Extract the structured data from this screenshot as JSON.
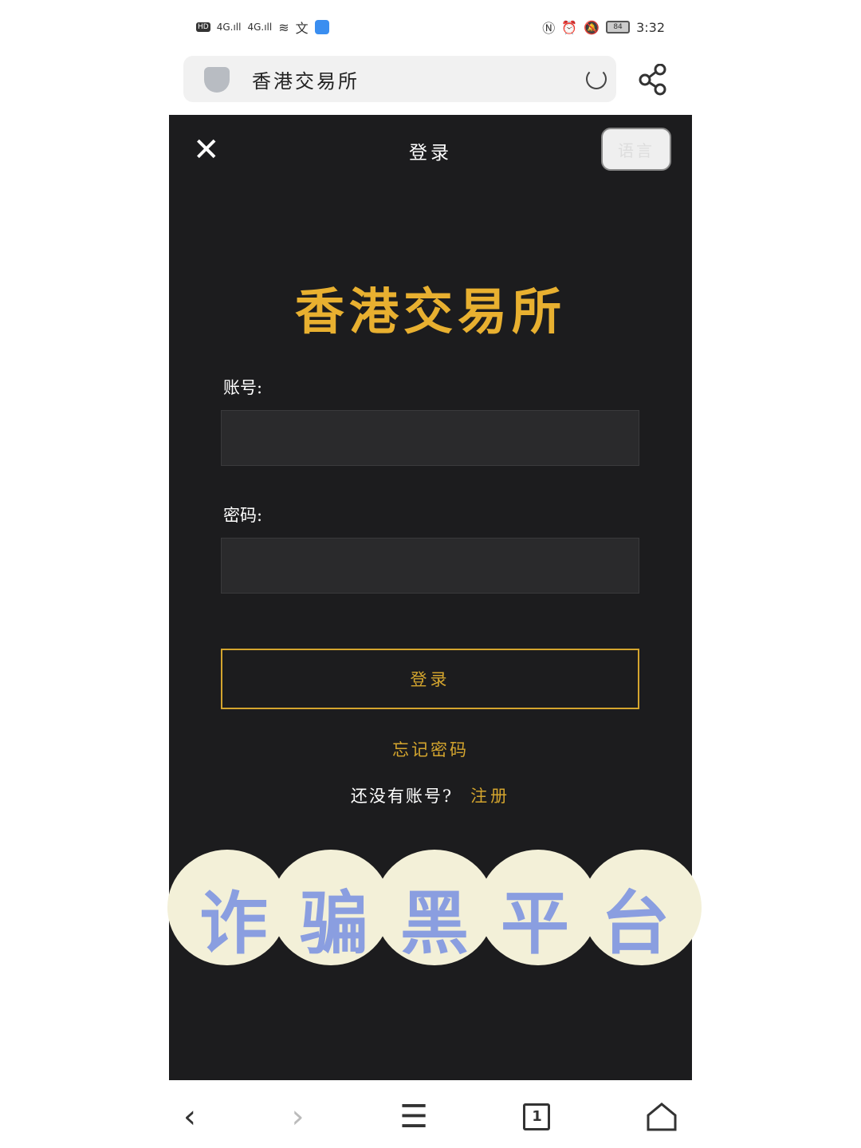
{
  "status": {
    "network": "4G",
    "battery": "84",
    "time": "3:32"
  },
  "browser": {
    "url_title": "香港交易所"
  },
  "header": {
    "title": "登录",
    "language_button": "语言"
  },
  "brand": "香港交易所",
  "form": {
    "account_label": "账号:",
    "account_value": "",
    "password_label": "密码:",
    "password_value": "",
    "login_button": "登录"
  },
  "forgot_password": "忘记密码",
  "register": {
    "prompt": "还没有账号?",
    "link": "注册"
  },
  "overlay": {
    "text": [
      "诈",
      "骗",
      "黑",
      "平",
      "台"
    ],
    "text_color": "#8a9ee0",
    "bg_color": "#f3f0d8"
  },
  "nav": {
    "tab_count": "1"
  },
  "colors": {
    "accent": "#d4a52e",
    "background": "#1c1c1e"
  }
}
